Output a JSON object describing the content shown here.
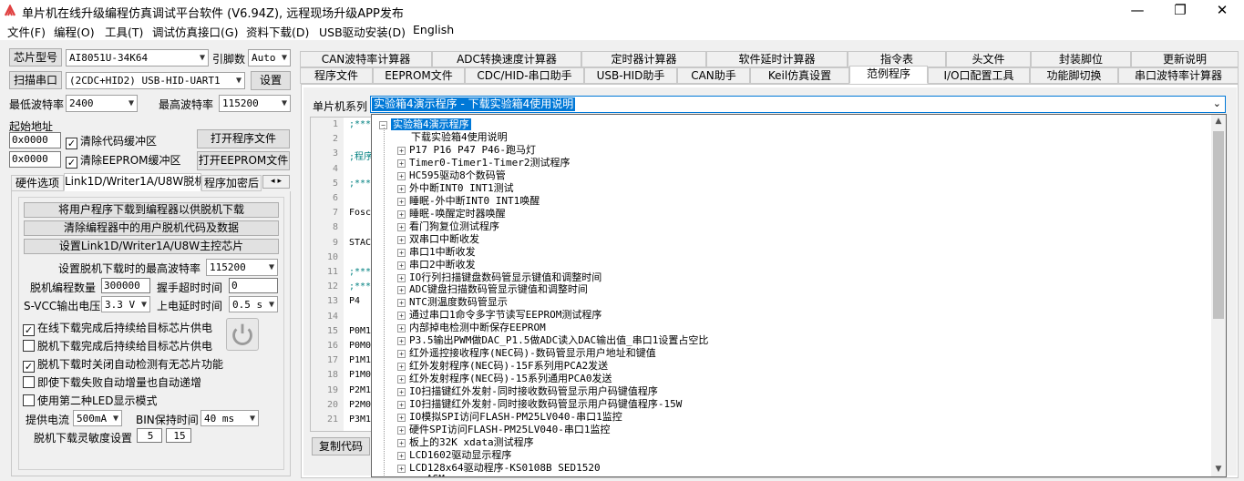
{
  "window": {
    "title": "单片机在线升级编程仿真调试平台软件 (V6.94Z), 远程现场升级APP发布",
    "min": "—",
    "max": "❐",
    "close": "✕"
  },
  "menu": [
    "文件(F)",
    "编程(O)",
    "工具(T)",
    "调试仿真接口(G)",
    "资料下载(D)",
    "USB驱动安装(D)",
    "English"
  ],
  "left": {
    "chip_btn": "芯片型号",
    "chip_value": "AI8051U-34K64",
    "pins_label": "引脚数",
    "pins_value": "Auto",
    "scan_btn": "扫描串口",
    "port_value": "(2CDC+HID2) USB-HID-UART1",
    "settings_btn": "设置",
    "min_baud_label": "最低波特率",
    "min_baud": "2400",
    "max_baud_label": "最高波特率",
    "max_baud": "115200",
    "start_addr_label": "起始地址",
    "addr1": "0x0000",
    "clear_code": "清除代码缓冲区",
    "open_prog": "打开程序文件",
    "addr2": "0x0000",
    "clear_eeprom": "清除EEPROM缓冲区",
    "open_eeprom": "打开EEPROM文件",
    "tabs": [
      "硬件选项",
      "Link1D/Writer1A/U8W脱机",
      "程序加密后"
    ],
    "offline": {
      "btn1": "将用户程序下载到编程器以供脱机下载",
      "btn2": "清除编程器中的用户脱机代码及数据",
      "btn3": "设置Link1D/Writer1A/U8W主控芯片",
      "max_baud_label": "设置脱机下载时的最高波特率",
      "max_baud": "115200",
      "count_label": "脱机编程数量",
      "count": "300000",
      "handshake_label": "握手超时时间",
      "handshake": "0",
      "svcc_label": "S-VCC输出电压",
      "svcc": "3.3 V",
      "delay_label": "上电延时时间",
      "delay": "0.5 s",
      "checks": [
        {
          "label": "在线下载完成后持续给目标芯片供电",
          "checked": "✓"
        },
        {
          "label": "脱机下载完成后持续给目标芯片供电",
          "checked": ""
        },
        {
          "label": "脱机下载时关闭自动检测有无芯片功能",
          "checked": "✓"
        },
        {
          "label": "即使下载失败自动增量也自动递增",
          "checked": ""
        },
        {
          "label": "使用第二种LED显示模式",
          "checked": ""
        }
      ],
      "current_label": "提供电流",
      "current": "500mA",
      "bin_label": "BIN保持时间",
      "bin": "40 ms",
      "sens_label": "脱机下载灵敏度设置",
      "sens1": "5",
      "sens2": "15"
    }
  },
  "tabs_row1": [
    "CAN波特率计算器",
    "ADC转换速度计算器",
    "定时器计算器",
    "软件延时计算器",
    "指令表",
    "头文件",
    "封装脚位",
    "更新说明"
  ],
  "tabs_row2": [
    "程序文件",
    "EEPROM文件",
    "CDC/HID-串口助手",
    "USB-HID助手",
    "CAN助手",
    "Keil仿真设置",
    "范例程序",
    "I/O口配置工具",
    "功能脚切换",
    "串口波特率计算器"
  ],
  "right": {
    "series_label": "单片机系列",
    "series_value": "实验箱4演示程序 - 下载实验箱4使用说明",
    "line_numbers": [
      "1",
      "2",
      "3",
      "4",
      "5",
      "6",
      "7",
      "8",
      "9",
      "10",
      "11",
      "12",
      "13",
      "14",
      "15",
      "16",
      "17",
      "18",
      "19",
      "20",
      "21"
    ],
    "code_snips": [
      ";***",
      "",
      ";程序",
      "",
      ";***",
      "",
      "Fosc",
      "",
      "STAC",
      "",
      "",
      ";***",
      ";***",
      "P4",
      "",
      "",
      "P0M1",
      "P0M0",
      "P1M1",
      "P1M0",
      "P2M1",
      "P2M0",
      "P3M1"
    ],
    "copy_btn": "复制代码",
    "tree_root": "实验箱4演示程序",
    "tree_first": "下载实验箱4使用说明",
    "tree_items": [
      "P17 P16 P47 P46-跑马灯",
      "Timer0-Timer1-Timer2测试程序",
      "HC595驱动8个数码管",
      "外中断INT0 INT1测试",
      "睡眠-外中断INT0 INT1唤醒",
      "睡眠-唤醒定时器唤醒",
      "看门狗复位测试程序",
      "双串口中断收发",
      "串口1中断收发",
      "串口2中断收发",
      "IO行列扫描键盘数码管显示键值和调整时间",
      "ADC键盘扫描数码管显示键值和调整时间",
      "NTC测温度数码管显示",
      "通过串口1命令多字节读写EEPROM测试程序",
      "内部掉电检测中断保存EEPROM",
      "P3.5输出PWM做DAC_P1.5做ADC读入DAC输出值_串口1设置占空比",
      "红外遥控接收程序(NEC码)-数码管显示用户地址和键值",
      "红外发射程序(NEC码)-15F系列用PCA2发送",
      "红外发射程序(NEC码)-15系列通用PCA0发送",
      "IO扫描键红外发射-同时接收数码管显示用户码键值程序",
      "IO扫描键红外发射-同时接收数码管显示用户码键值程序-15W",
      "IO模拟SPI访问FLASH-PM25LV040-串口1监控",
      "硬件SPI访问FLASH-PM25LV040-串口1监控",
      "板上的32K xdata测试程序",
      "LCD1602驱动显示程序",
      "LCD128x64驱动程序-KS0108B SED1520"
    ],
    "tree_last_partial": "ASM"
  },
  "colors": {
    "accent": "#0078d7",
    "selected": "#0078d7"
  }
}
